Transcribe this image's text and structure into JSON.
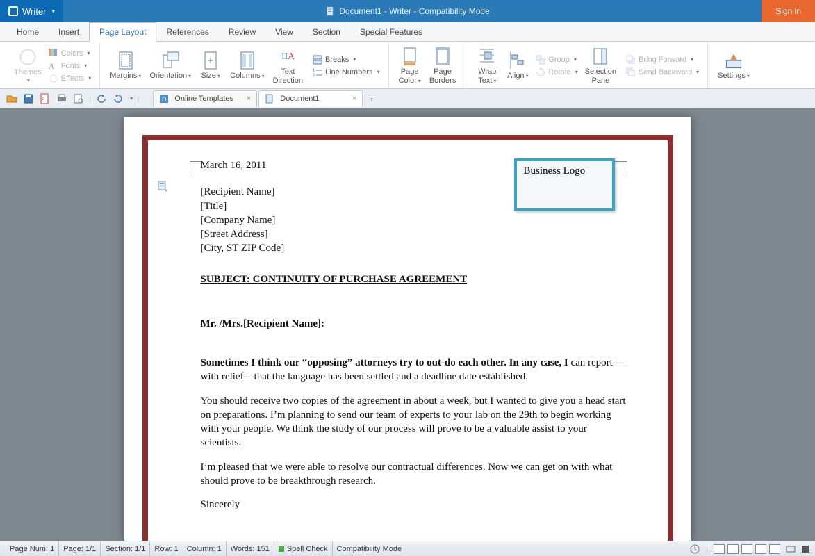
{
  "app": {
    "name": "Writer",
    "title": "Document1 - Writer - Compatibility Mode",
    "signin": "Sign in"
  },
  "menu": {
    "tabs": [
      "Home",
      "Insert",
      "Page Layout",
      "References",
      "Review",
      "View",
      "Section",
      "Special Features"
    ],
    "active": 2
  },
  "ribbon": {
    "themes": "Themes",
    "colors": "Colors",
    "fonts": "Fonts",
    "effects": "Effects",
    "margins": "Margins",
    "orientation": "Orientation",
    "size": "Size",
    "columns": "Columns",
    "textdir": "Text\nDirection",
    "breaks": "Breaks",
    "linenums": "Line Numbers",
    "pagecolor": "Page\nColor",
    "pageborders": "Page\nBorders",
    "wrap": "Wrap\nText",
    "align": "Align",
    "group": "Group",
    "rotate": "Rotate",
    "selpane": "Selection\nPane",
    "bringfwd": "Bring Forward",
    "sendback": "Send Backward",
    "settings": "Settings"
  },
  "doctabs": {
    "t0": "Online Templates",
    "t1": "Document1"
  },
  "document": {
    "date": "March 16, 2011",
    "r1": "[Recipient Name]",
    "r2": "[Title]",
    "r3": "[Company Name]",
    "r4": "[Street Address]",
    "r5": "[City, ST  ZIP Code]",
    "subject": "SUBJECT: CONTINUITY OF PURCHASE AGREEMENT ",
    "greet": "Mr. /Mrs.[Recipient Name]:",
    "p1a": "Sometimes I think our “opposing” attorneys try to out-do each other. In any case, I",
    "p1b": " can report—with relief—that the language has been settled and a deadline date established.",
    "p2": "You should receive two copies of the agreement in about a week, but I wanted to give you a head start on preparations. I’m planning to send our team of experts to your lab on the 29th to begin working with your people. We think the study of our process will prove to be a valuable assist to your scientists.",
    "p3": "I’m pleased that we were able to resolve our contractual differences. Now we can get on with what should prove to be breakthrough research.",
    "p4": "Sincerely",
    "logo": "Business Logo"
  },
  "status": {
    "pagenum": "Page Num: 1",
    "page": "Page: 1/1",
    "section": "Section: 1/1",
    "row": "Row: 1",
    "col": "Column: 1",
    "words": "Words: 151",
    "spell": "Spell Check",
    "compat": "Compatibility Mode"
  }
}
